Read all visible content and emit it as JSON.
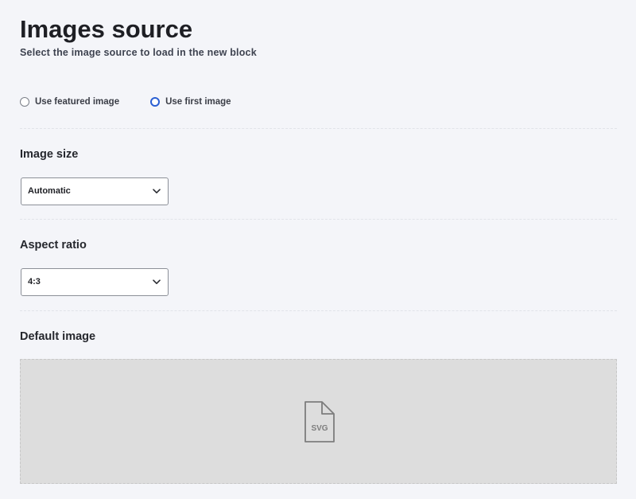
{
  "header": {
    "title": "Images source",
    "subtitle": "Select the image source to load in the new block"
  },
  "image_source": {
    "options": [
      {
        "label": "Use featured image",
        "selected": false
      },
      {
        "label": "Use first image",
        "selected": true
      }
    ]
  },
  "image_size": {
    "label": "Image size",
    "selected": "Automatic"
  },
  "aspect_ratio": {
    "label": "Aspect ratio",
    "selected": "4:3"
  },
  "default_image": {
    "label": "Default image",
    "icon_text": "SVG",
    "icon": "svg-file-icon"
  },
  "colors": {
    "accent": "#2a5fd3",
    "background": "#f4f5f9",
    "dropzone": "#dddddd"
  }
}
